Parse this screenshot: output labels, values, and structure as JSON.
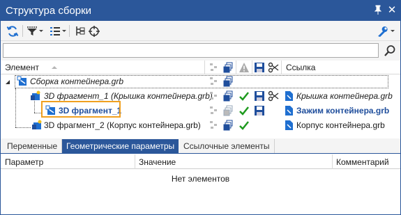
{
  "window": {
    "title": "Структура сборки",
    "pin_icon": "pin-icon",
    "close_icon": "close-icon"
  },
  "search": {
    "value": "",
    "placeholder": ""
  },
  "tree": {
    "columns": {
      "element": "Элемент",
      "link": "Ссылка"
    },
    "rows": [
      {
        "name": "Сборка контейнера.grb",
        "link": ""
      },
      {
        "name": "3D фрагмент_1 (Крышка контейнера.grb)",
        "link": "Крышка контейнера.grb"
      },
      {
        "name": "3D фрагмент_1",
        "link": "Зажим контейнера.grb"
      },
      {
        "name": "3D фрагмент_2 (Корпус контейнера.grb)",
        "link": "Корпус контейнера.grb"
      }
    ]
  },
  "tabs": [
    {
      "label": "Переменные"
    },
    {
      "label": "Геометрические параметры"
    },
    {
      "label": "Ссылочные элементы"
    }
  ],
  "params": {
    "columns": {
      "param": "Параметр",
      "value": "Значение",
      "comment": "Комментарий"
    },
    "empty_text": "Нет элементов"
  },
  "colors": {
    "accent": "#2b579a",
    "check": "#1e9a1e",
    "highlight": "#f0a020",
    "link_blue": "#1f4e9c"
  }
}
